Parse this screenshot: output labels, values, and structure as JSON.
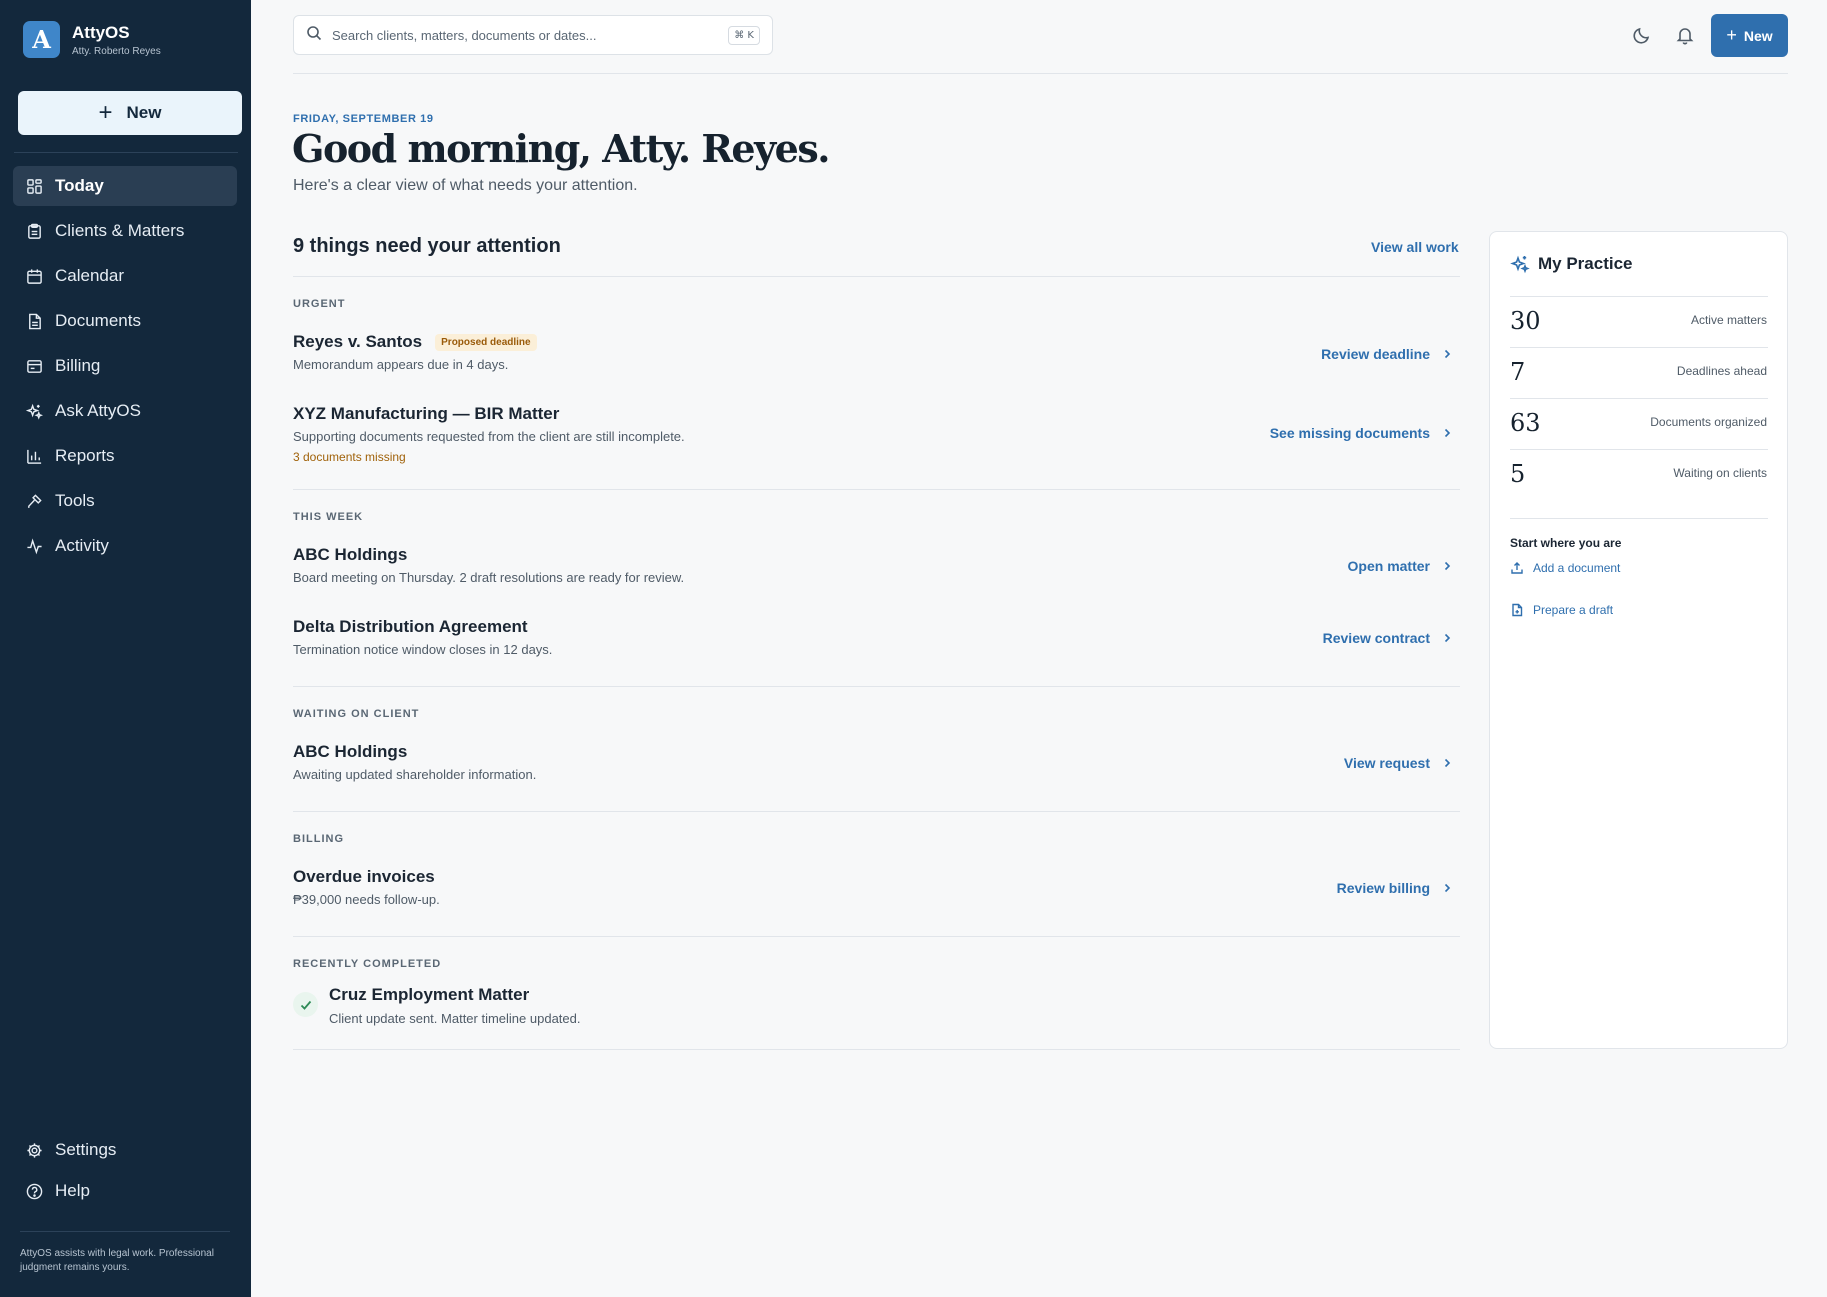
{
  "app": {
    "name": "AttyOS",
    "user": "Atty. Roberto Reyes",
    "logo_letter": "A"
  },
  "sidebar": {
    "new_label": "New",
    "items": [
      {
        "label": "Today",
        "icon": "grid-icon",
        "active": true
      },
      {
        "label": "Clients & Matters",
        "icon": "clipboard-icon"
      },
      {
        "label": "Calendar",
        "icon": "calendar-icon"
      },
      {
        "label": "Documents",
        "icon": "document-icon"
      },
      {
        "label": "Billing",
        "icon": "billing-icon"
      },
      {
        "label": "Ask AttyOS",
        "icon": "sparkle-icon"
      },
      {
        "label": "Reports",
        "icon": "bar-chart-icon"
      },
      {
        "label": "Tools",
        "icon": "hammer-icon"
      },
      {
        "label": "Activity",
        "icon": "activity-icon"
      }
    ],
    "bottom_items": [
      {
        "label": "Settings",
        "icon": "gear-icon"
      },
      {
        "label": "Help",
        "icon": "help-icon"
      }
    ],
    "footer": "AttyOS assists with legal work. Professional judgment remains yours."
  },
  "topbar": {
    "search_placeholder": "Search clients, matters, documents or dates...",
    "shortcut": "⌘ K",
    "new_label": "New"
  },
  "greeting": {
    "date": "FRIDAY, SEPTEMBER 19",
    "title": "Good morning, Atty. Reyes.",
    "subtitle": "Here's a clear view of what needs your attention."
  },
  "attention": {
    "title": "9 things need your attention",
    "view_all": "View all work",
    "sections": [
      {
        "label": "URGENT",
        "items": [
          {
            "title": "Reyes v. Santos",
            "badge": "Proposed deadline",
            "desc": "Memorandum appears due in 4 days.",
            "action": "Review deadline"
          },
          {
            "title": "XYZ Manufacturing — BIR Matter",
            "desc": "Supporting documents requested from the client are still incomplete.",
            "warning": "3 documents missing",
            "action": "See missing documents"
          }
        ]
      },
      {
        "label": "THIS WEEK",
        "items": [
          {
            "title": "ABC Holdings",
            "desc": "Board meeting on Thursday. 2 draft resolutions are ready for review.",
            "action": "Open matter"
          },
          {
            "title": "Delta Distribution Agreement",
            "desc": "Termination notice window closes in 12 days.",
            "action": "Review contract"
          }
        ]
      },
      {
        "label": "WAITING ON CLIENT",
        "items": [
          {
            "title": "ABC Holdings",
            "desc": "Awaiting updated shareholder information.",
            "action": "View request"
          }
        ]
      },
      {
        "label": "BILLING",
        "items": [
          {
            "title": "Overdue invoices",
            "desc": "₱39,000 needs follow-up.",
            "action": "Review billing"
          }
        ]
      },
      {
        "label": "RECENTLY COMPLETED",
        "items": [
          {
            "title": "Cruz Employment Matter",
            "desc": "Client update sent. Matter timeline updated."
          }
        ]
      }
    ]
  },
  "practice": {
    "title": "My Practice",
    "stats": [
      {
        "value": "30",
        "label": "Active matters"
      },
      {
        "value": "7",
        "label": "Deadlines ahead"
      },
      {
        "value": "63",
        "label": "Documents organized"
      },
      {
        "value": "5",
        "label": "Waiting on clients"
      }
    ],
    "start_title": "Start where you are",
    "links": [
      {
        "label": "Add a document",
        "icon": "upload-icon"
      },
      {
        "label": "Prepare a draft",
        "icon": "file-plus-icon"
      }
    ]
  },
  "colors": {
    "sidebar_bg": "#13283c",
    "accent": "#2f6fae",
    "warning": "#a0620a",
    "badge_bg": "#fbefd8",
    "success": "#2e8b57"
  }
}
